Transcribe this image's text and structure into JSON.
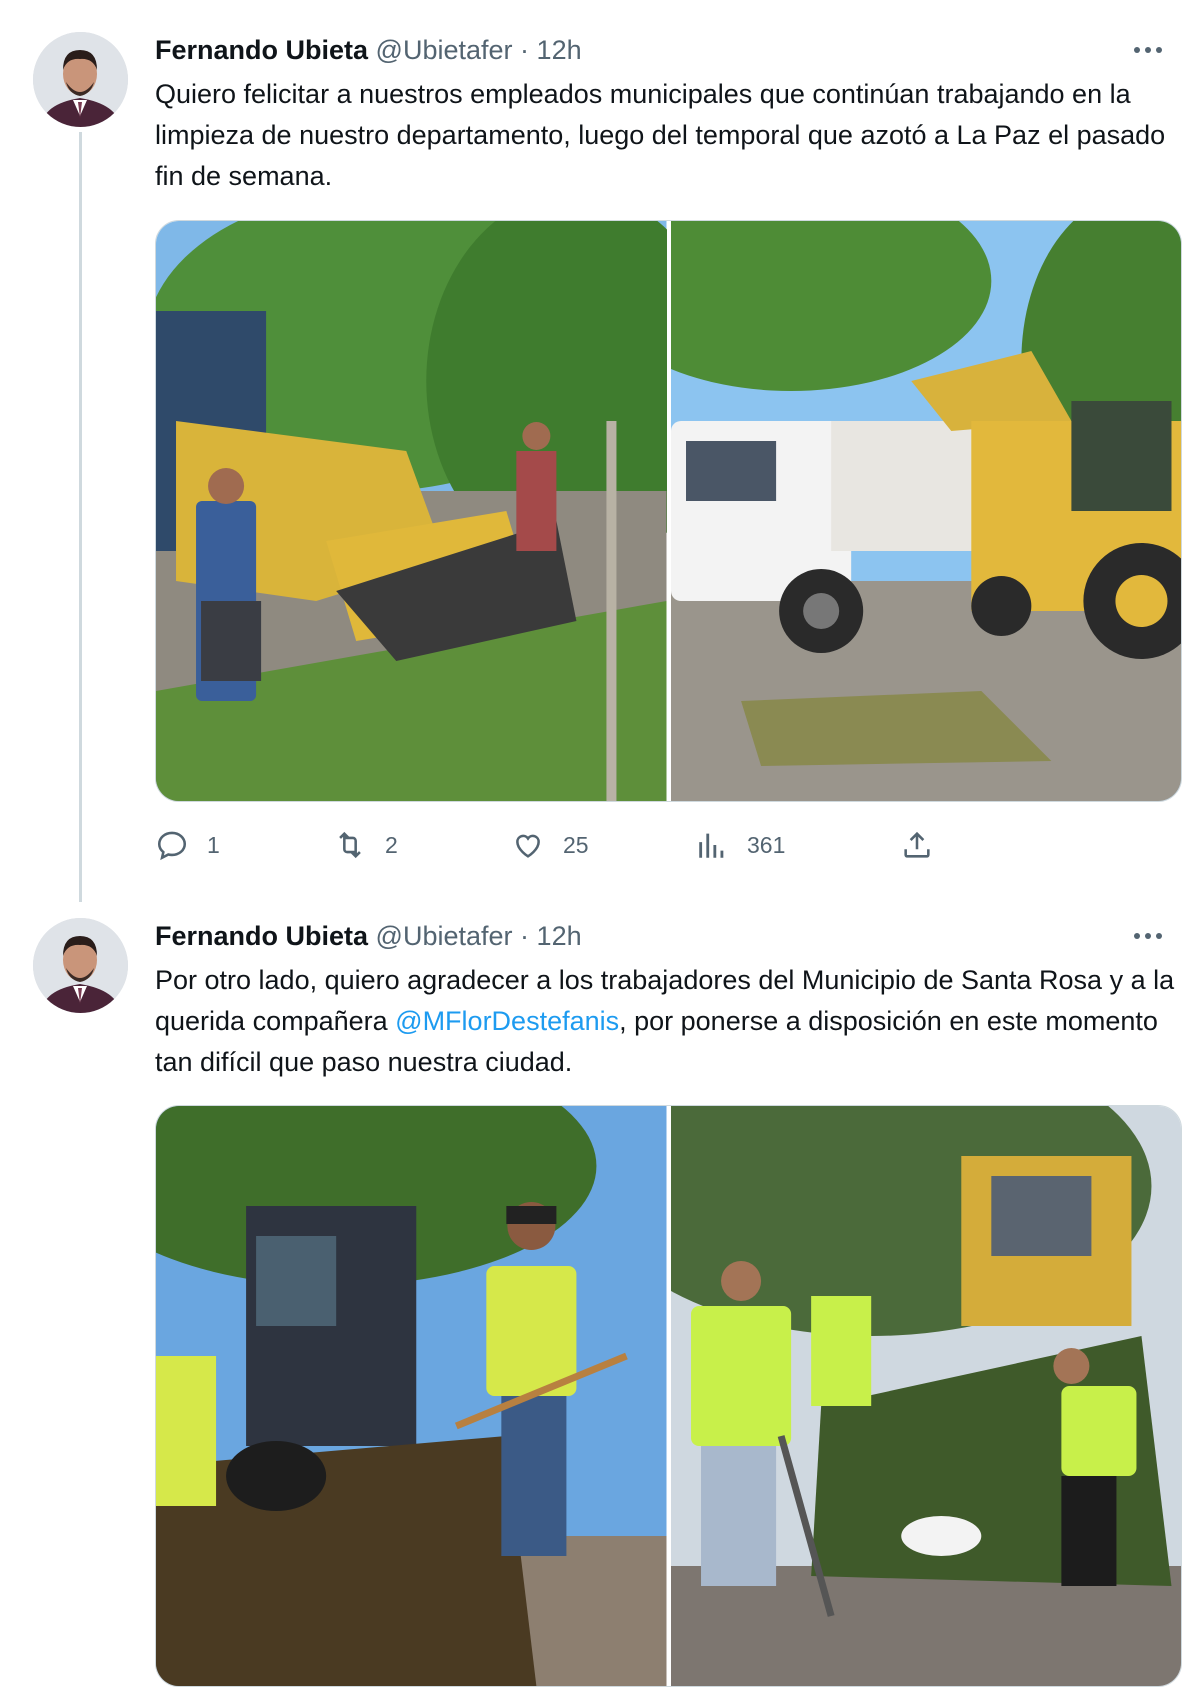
{
  "tweets": [
    {
      "author_name": "Fernando Ubieta",
      "handle": "@Ubietafer",
      "separator": "·",
      "time": "12h",
      "text": "Quiero felicitar a nuestros empleados municipales que continúan trabajando en la limpieza de nuestro departamento, luego del temporal que azotó a La Paz el pasado fin de semana.",
      "replies": "1",
      "retweets": "2",
      "likes": "25",
      "views": "361"
    },
    {
      "author_name": "Fernando Ubieta",
      "handle": "@Ubietafer",
      "separator": "·",
      "time": "12h",
      "text_before": "Por otro lado, quiero agradecer a los trabajadores del Municipio de Santa Rosa y a la querida compañera ",
      "mention": "@MFlorDestefanis",
      "text_after": ", por ponerse a disposición en este momento tan difícil que paso nuestra ciudad."
    }
  ],
  "icons": {
    "more": "more-horizontal-icon",
    "reply": "reply-icon",
    "retweet": "retweet-icon",
    "like": "heart-icon",
    "views": "views-bar-icon",
    "share": "share-icon"
  },
  "colors": {
    "text": "#0f1419",
    "secondary": "#536471",
    "mention": "#1d9bf0",
    "border": "#cfd9de"
  }
}
